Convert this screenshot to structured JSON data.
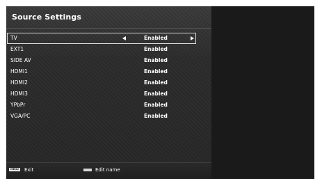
{
  "header": {
    "title": "Source Settings"
  },
  "sources": [
    {
      "name": "TV",
      "value": "Enabled",
      "selected": true
    },
    {
      "name": "EXT1",
      "value": "Enabled",
      "selected": false
    },
    {
      "name": "SIDE AV",
      "value": "Enabled",
      "selected": false
    },
    {
      "name": "HDMI1",
      "value": "Enabled",
      "selected": false
    },
    {
      "name": "HDMI2",
      "value": "Enabled",
      "selected": false
    },
    {
      "name": "HDMI3",
      "value": "Enabled",
      "selected": false
    },
    {
      "name": "YPbPr",
      "value": "Enabled",
      "selected": false
    },
    {
      "name": "VGA/PC",
      "value": "Enabled",
      "selected": false
    }
  ],
  "footer": {
    "menu_key": "MENU",
    "exit_label": "Exit",
    "edit_label": "Edit name"
  },
  "icons": {
    "left": "arrow-left-icon",
    "right": "arrow-right-icon",
    "menu": "menu-key-icon",
    "edit": "grey-key-icon"
  }
}
